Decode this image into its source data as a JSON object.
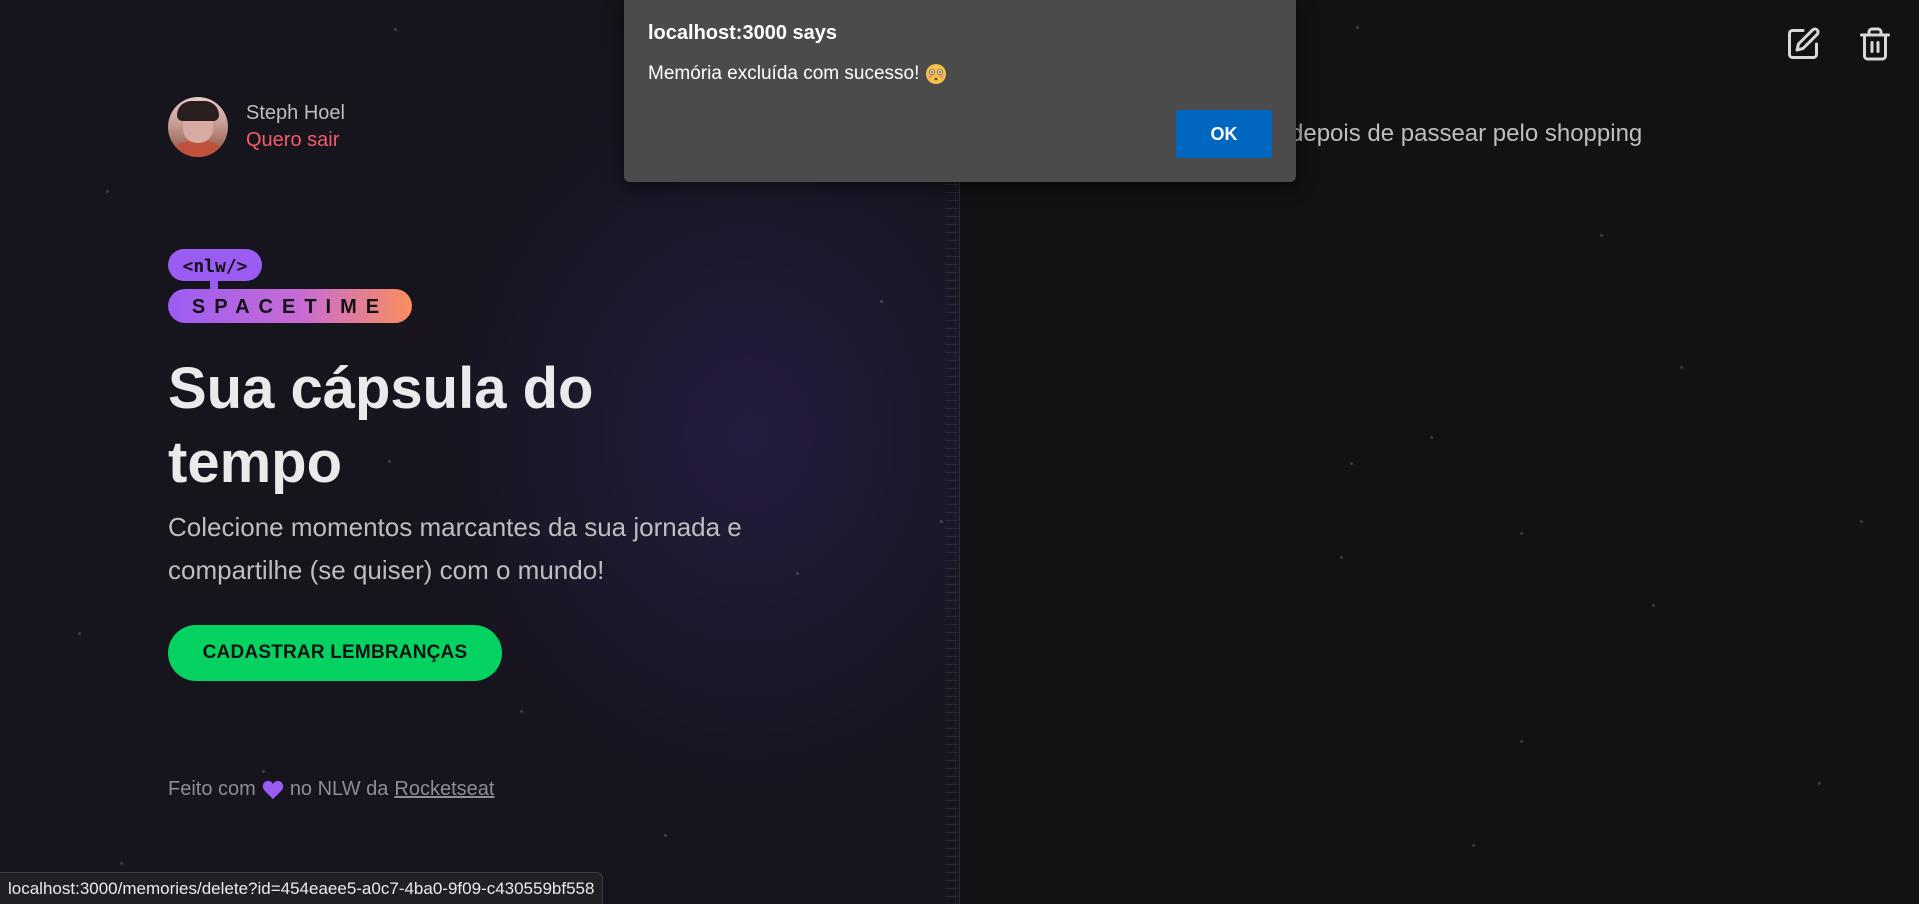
{
  "dialog": {
    "title": "localhost:3000 says",
    "message": "Memória excluída com sucesso!",
    "emoji": "flushed-face",
    "ok_label": "OK"
  },
  "profile": {
    "name": "Steph Hoel",
    "logout_label": "Quero sair"
  },
  "logo": {
    "badge_text": "<nlw/>",
    "word_text": "SPACETIME"
  },
  "hero": {
    "headline": "Sua cápsula do tempo",
    "subtitle": "Colecione momentos marcantes da sua jornada e compartilhe (se quiser) com o mundo!",
    "cta_label": "CADASTRAR LEMBRANÇAS"
  },
  "footer": {
    "prefix": "Feito com",
    "middle": "no NLW da",
    "link_label": "Rocketseat"
  },
  "memory": {
    "text": "depois de passear pelo shopping"
  },
  "actions": {
    "edit_icon": "pencil-square-icon",
    "delete_icon": "trash-icon"
  },
  "status_bar": {
    "url": "localhost:3000/memories/delete?id=454eaee5-a0c7-4ba0-9f09-c430559bf558"
  },
  "colors": {
    "accent_green": "#04d361",
    "logout_red": "#f75a68",
    "dialog_bg": "#4b4b4b",
    "ok_blue": "#0067c0",
    "heart_purple": "#9b5cf3"
  }
}
